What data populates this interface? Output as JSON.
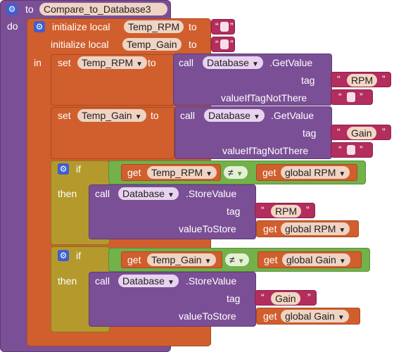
{
  "procedure": {
    "to_label": "to",
    "name": "Compare_to_Database3",
    "do_label": "do"
  },
  "locals": {
    "init_label": "initialize local",
    "to_label": "to",
    "var1": "Temp_RPM",
    "var2": "Temp_Gain",
    "in_label": "in"
  },
  "set1": {
    "set_label": "set",
    "var": "Temp_RPM",
    "to_label": "to",
    "call_label": "call",
    "component": "Database",
    "method": ".GetValue",
    "tag_label": "tag",
    "tag_value": "RPM",
    "default_label": "valueIfTagNotThere"
  },
  "set2": {
    "set_label": "set",
    "var": "Temp_Gain",
    "to_label": "to",
    "call_label": "call",
    "component": "Database",
    "method": ".GetValue",
    "tag_label": "tag",
    "tag_value": "Gain",
    "default_label": "valueIfTagNotThere"
  },
  "if1": {
    "if_label": "if",
    "then_label": "then",
    "get_label": "get",
    "left_var": "Temp_RPM",
    "op": "≠",
    "right_var": "global RPM",
    "call_label": "call",
    "component": "Database",
    "method": ".StoreValue",
    "tag_label": "tag",
    "tag_value": "RPM",
    "store_label": "valueToStore",
    "store_var": "global RPM"
  },
  "if2": {
    "if_label": "if",
    "then_label": "then",
    "get_label": "get",
    "left_var": "Temp_Gain",
    "op": "≠",
    "right_var": "global Gain",
    "call_label": "call",
    "component": "Database",
    "method": ".StoreValue",
    "tag_label": "tag",
    "tag_value": "Gain",
    "store_label": "valueToStore",
    "store_var": "global Gain"
  },
  "quote_open": "“",
  "quote_close": "”",
  "icons": {
    "mutator": "gear-icon",
    "dropdown": "dropdown-arrow-icon"
  }
}
